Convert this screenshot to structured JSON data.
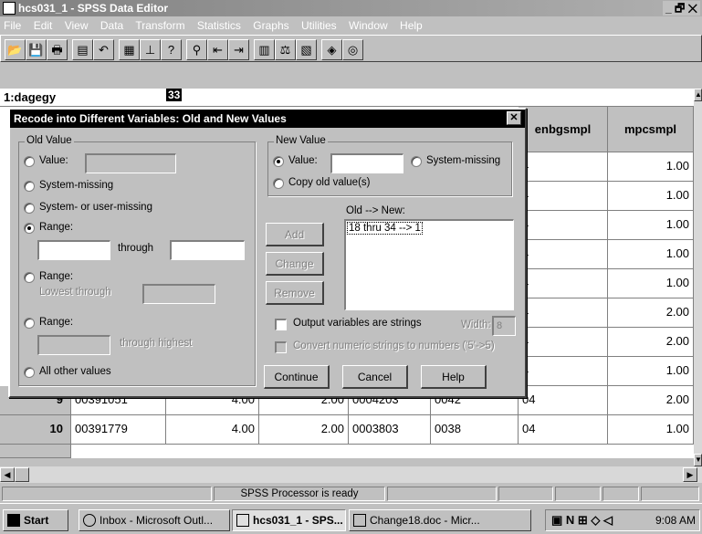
{
  "window": {
    "title": "hcs031_1 - SPSS Data Editor",
    "controls": "_ 🗗 ✕"
  },
  "menu": [
    "File",
    "Edit",
    "View",
    "Data",
    "Transform",
    "Statistics",
    "Graphs",
    "Utilities",
    "Window",
    "Help"
  ],
  "cell_editor": {
    "ref": "1:dagegy",
    "value": "33"
  },
  "columns": [
    "enbgsmpl",
    "mpcsmpl"
  ],
  "visible_col_values": [
    [
      "4",
      "1.00"
    ],
    [
      "4",
      "1.00"
    ],
    [
      "4",
      "1.00"
    ],
    [
      "4",
      "1.00"
    ],
    [
      "4",
      "1.00"
    ],
    [
      "4",
      "2.00"
    ],
    [
      "4",
      "2.00"
    ],
    [
      "4",
      "1.00"
    ]
  ],
  "rows": [
    {
      "num": "9",
      "c1": "00391051",
      "c2": "4.00",
      "c3": "2.00",
      "c4": "0004203",
      "c5": "0042",
      "c6": "04",
      "c7": "2.00"
    },
    {
      "num": "10",
      "c1": "00391779",
      "c2": "4.00",
      "c3": "2.00",
      "c4": "0003803",
      "c5": "0038",
      "c6": "04",
      "c7": "1.00"
    }
  ],
  "dialog": {
    "title": "Recode into Different Variables: Old and New Values",
    "close": "✕",
    "old_value": {
      "legend": "Old Value",
      "value": "Value:",
      "system_missing": "System-missing",
      "sys_or_user": "System- or user-missing",
      "range": "Range:",
      "through": "through",
      "range2": "Range:",
      "lowest_through": "Lowest through",
      "range3": "Range:",
      "through_highest": "through highest",
      "all_other": "All other values"
    },
    "new_value": {
      "legend": "New Value",
      "value": "Value:",
      "system_missing": "System-missing",
      "copy_old": "Copy old value(s)"
    },
    "old_new_label": "Old --> New:",
    "mapping": [
      "18 thru 34 --> 1"
    ],
    "buttons": {
      "add": "Add",
      "change": "Change",
      "remove": "Remove",
      "continue": "Continue",
      "cancel": "Cancel",
      "help": "Help"
    },
    "output_strings": "Output variables are strings",
    "width_label": "Width:",
    "width_value": "8",
    "convert": "Convert numeric strings to numbers ('5'->5)"
  },
  "status": "SPSS Processor is ready",
  "taskbar": {
    "start": "Start",
    "tasks": [
      "Inbox - Microsoft Outl...",
      "hcs031_1 - SPS...",
      "Change18.doc - Micr..."
    ],
    "clock": "9:08 AM"
  }
}
